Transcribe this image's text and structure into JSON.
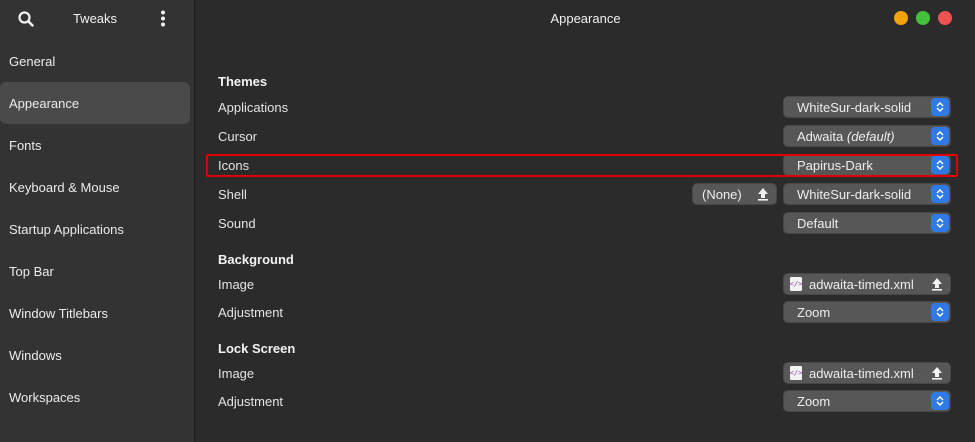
{
  "sidebar": {
    "title": "Tweaks",
    "items": [
      {
        "label": "General",
        "active": false
      },
      {
        "label": "Appearance",
        "active": true
      },
      {
        "label": "Fonts",
        "active": false
      },
      {
        "label": "Keyboard & Mouse",
        "active": false
      },
      {
        "label": "Startup Applications",
        "active": false
      },
      {
        "label": "Top Bar",
        "active": false
      },
      {
        "label": "Window Titlebars",
        "active": false
      },
      {
        "label": "Windows",
        "active": false
      },
      {
        "label": "Workspaces",
        "active": false
      }
    ]
  },
  "header": {
    "title": "Appearance"
  },
  "themes": {
    "section_title": "Themes",
    "applications": {
      "label": "Applications",
      "value": "WhiteSur-dark-solid"
    },
    "cursor": {
      "label": "Cursor",
      "value": "Adwaita",
      "value_suffix": "(default)"
    },
    "icons": {
      "label": "Icons",
      "value": "Papirus-Dark"
    },
    "shell": {
      "label": "Shell",
      "none_label": "(None)",
      "value": "WhiteSur-dark-solid"
    },
    "sound": {
      "label": "Sound",
      "value": "Default"
    }
  },
  "background": {
    "section_title": "Background",
    "image": {
      "label": "Image",
      "value": "adwaita-timed.xml"
    },
    "adjustment": {
      "label": "Adjustment",
      "value": "Zoom"
    }
  },
  "lock_screen": {
    "section_title": "Lock Screen",
    "image": {
      "label": "Image",
      "value": "adwaita-timed.xml"
    },
    "adjustment": {
      "label": "Adjustment",
      "value": "Zoom"
    }
  },
  "colors": {
    "accent": "#2f7ae5",
    "highlight_border": "#e00000",
    "window_minimize": "#f0a30a",
    "window_maximize": "#42c13a",
    "window_close": "#ef5350"
  }
}
